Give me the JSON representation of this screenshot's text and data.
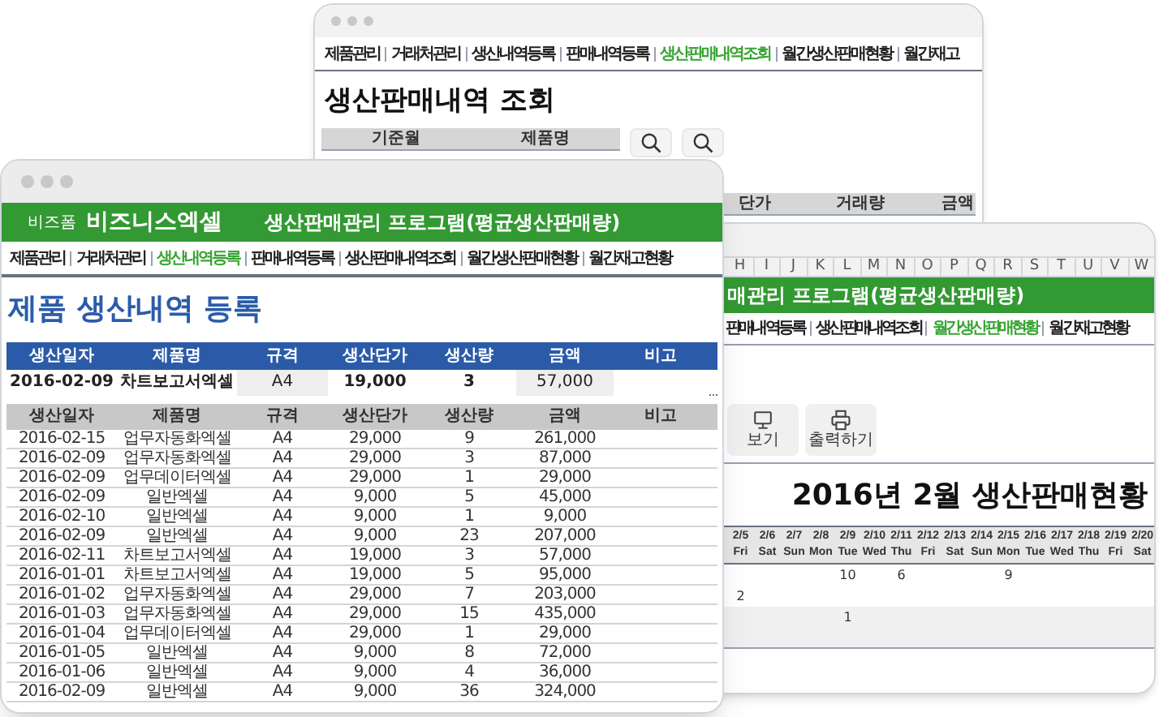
{
  "back_window": {
    "menu": [
      {
        "label": "제품관리",
        "selected": false
      },
      {
        "label": "거래처관리",
        "selected": false
      },
      {
        "label": "생산내역등록",
        "selected": false
      },
      {
        "label": "판매내역등록",
        "selected": false
      },
      {
        "label": "생산판매내역조회",
        "selected": true
      },
      {
        "label": "월간생산판매현황",
        "selected": false
      },
      {
        "label": "월간재고",
        "selected": false
      }
    ],
    "page_title": "생산판매내역 조회",
    "filter_columns": [
      "기준월",
      "제품명"
    ],
    "table_columns": [
      "단가",
      "거래량",
      "금액"
    ]
  },
  "right_window": {
    "column_letters": [
      "H",
      "I",
      "J",
      "K",
      "L",
      "M",
      "N",
      "O",
      "P",
      "Q",
      "R",
      "S",
      "T",
      "U",
      "V",
      "W"
    ],
    "program_title": "매관리 프로그램(평균생산판매량)",
    "menu": [
      {
        "label": "판매내역등록",
        "selected": false
      },
      {
        "label": "생산판매내역조회",
        "selected": false
      },
      {
        "label": "월간생산판매현황",
        "selected": true
      },
      {
        "label": "월간재고현황",
        "selected": false
      }
    ],
    "buttons": [
      {
        "kind": "monitor",
        "label": "보기"
      },
      {
        "kind": "printer",
        "label": "출력하기"
      }
    ],
    "report_title": "2016년 2월 생산판매현황",
    "dates": [
      {
        "date": "2/5",
        "day": "Fri"
      },
      {
        "date": "2/6",
        "day": "Sat"
      },
      {
        "date": "2/7",
        "day": "Sun"
      },
      {
        "date": "2/8",
        "day": "Mon"
      },
      {
        "date": "2/9",
        "day": "Tue"
      },
      {
        "date": "2/10",
        "day": "Wed"
      },
      {
        "date": "2/11",
        "day": "Thu"
      },
      {
        "date": "2/12",
        "day": "Fri"
      },
      {
        "date": "2/13",
        "day": "Sat"
      },
      {
        "date": "2/14",
        "day": "Sun"
      },
      {
        "date": "2/15",
        "day": "Mon"
      },
      {
        "date": "2/16",
        "day": "Tue"
      },
      {
        "date": "2/17",
        "day": "Wed"
      },
      {
        "date": "2/18",
        "day": "Thu"
      },
      {
        "date": "2/19",
        "day": "Fri"
      },
      {
        "date": "2/20",
        "day": "Sat"
      }
    ],
    "rows": [
      [
        null,
        null,
        null,
        null,
        "10",
        null,
        "6",
        null,
        null,
        null,
        "9",
        null,
        null,
        null,
        null,
        null
      ],
      [
        "2",
        null,
        null,
        null,
        null,
        null,
        null,
        null,
        null,
        null,
        null,
        null,
        null,
        null,
        null,
        null
      ],
      [
        null,
        null,
        null,
        null,
        "1",
        null,
        null,
        null,
        null,
        null,
        null,
        null,
        null,
        null,
        null,
        null
      ]
    ]
  },
  "front_window": {
    "brand_small": "비즈폼",
    "brand": "비즈니스엑셀",
    "program_title": "생산판매관리 프로그램(평균생산판매량)",
    "menu": [
      {
        "label": "제품관리",
        "selected": false
      },
      {
        "label": "거래처관리",
        "selected": false
      },
      {
        "label": "생산내역등록",
        "selected": true
      },
      {
        "label": "판매내역등록",
        "selected": false
      },
      {
        "label": "생산판매내역조회",
        "selected": false
      },
      {
        "label": "월간생산판매현황",
        "selected": false
      },
      {
        "label": "월간재고현황",
        "selected": false
      }
    ],
    "page_title": "제품 생산내역 등록",
    "entry_table": {
      "columns": [
        "생산일자",
        "제품명",
        "규격",
        "생산단가",
        "생산량",
        "금액",
        "비고"
      ],
      "row": [
        "2016-02-09",
        "차트보고서엑셀",
        "A4",
        "19,000",
        "3",
        "57,000"
      ]
    },
    "list_table": {
      "columns": [
        "생산일자",
        "제품명",
        "규격",
        "생산단가",
        "생산량",
        "금액",
        "비고"
      ],
      "rows": [
        [
          "2016-02-15",
          "업무자동화엑셀",
          "A4",
          "29,000",
          "9",
          "261,000"
        ],
        [
          "2016-02-09",
          "업무자동화엑셀",
          "A4",
          "29,000",
          "3",
          "87,000"
        ],
        [
          "2016-02-09",
          "업무데이터엑셀",
          "A4",
          "29,000",
          "1",
          "29,000"
        ],
        [
          "2016-02-09",
          "일반엑셀",
          "A4",
          "9,000",
          "5",
          "45,000"
        ],
        [
          "2016-02-10",
          "일반엑셀",
          "A4",
          "9,000",
          "1",
          "9,000"
        ],
        [
          "2016-02-09",
          "일반엑셀",
          "A4",
          "9,000",
          "23",
          "207,000"
        ],
        [
          "2016-02-11",
          "차트보고서엑셀",
          "A4",
          "19,000",
          "3",
          "57,000"
        ],
        [
          "2016-01-01",
          "차트보고서엑셀",
          "A4",
          "19,000",
          "5",
          "95,000"
        ],
        [
          "2016-01-02",
          "업무자동화엑셀",
          "A4",
          "29,000",
          "7",
          "203,000"
        ],
        [
          "2016-01-03",
          "업무자동화엑셀",
          "A4",
          "29,000",
          "15",
          "435,000"
        ],
        [
          "2016-01-04",
          "업무데이터엑셀",
          "A4",
          "29,000",
          "1",
          "29,000"
        ],
        [
          "2016-01-05",
          "일반엑셀",
          "A4",
          "9,000",
          "8",
          "72,000"
        ],
        [
          "2016-01-06",
          "일반엑셀",
          "A4",
          "9,000",
          "4",
          "36,000"
        ],
        [
          "2016-02-09",
          "일반엑셀",
          "A4",
          "9,000",
          "36",
          "324,000"
        ]
      ]
    }
  }
}
